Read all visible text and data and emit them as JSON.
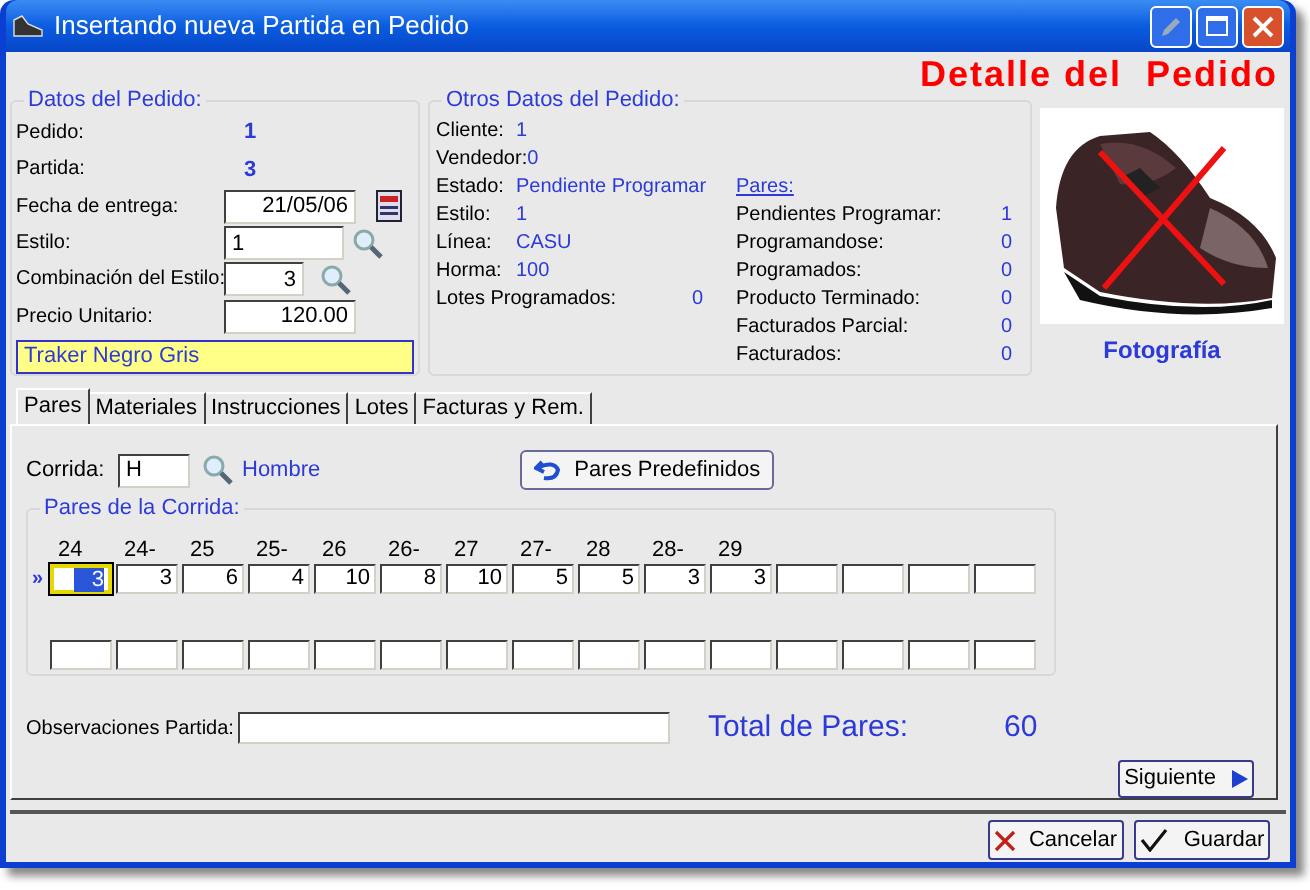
{
  "window": {
    "title": "Insertando nueva Partida en Pedido"
  },
  "heading": "Detalle del  Pedido",
  "datos": {
    "legend": "Datos del Pedido:",
    "fields": [
      {
        "label": "Pedido:",
        "value": "1",
        "kind": "value"
      },
      {
        "label": "Partida:",
        "value": "3",
        "kind": "value"
      },
      {
        "label": "Fecha de entrega:",
        "value": "21/05/06",
        "kind": "date"
      },
      {
        "label": "Estilo:",
        "value": "1",
        "kind": "lookup_left"
      },
      {
        "label": "Combinación del Estilo:",
        "value": "3",
        "kind": "lookup_short"
      },
      {
        "label": "Precio Unitario:",
        "value": "120.00",
        "kind": "input"
      }
    ],
    "description": "Traker Negro Gris"
  },
  "otros": {
    "legend": "Otros Datos del Pedido:",
    "fields": [
      {
        "label": "Cliente:",
        "value": "1"
      },
      {
        "label": "Vendedor:",
        "value": "0"
      },
      {
        "label": "Estado:",
        "value": "Pendiente Programar"
      },
      {
        "label": "Estilo:",
        "value": "1"
      },
      {
        "label": "Línea:",
        "value": "CASU"
      },
      {
        "label": "Horma:",
        "value": "100"
      },
      {
        "label": "Lotes Programados:",
        "value": "0"
      }
    ],
    "pares_title": "Pares:",
    "pares": [
      {
        "label": "Pendientes Programar:",
        "value": "1"
      },
      {
        "label": "Programandose:",
        "value": "0"
      },
      {
        "label": "Programados:",
        "value": "0"
      },
      {
        "label": "Producto Terminado:",
        "value": "0"
      },
      {
        "label": "Facturados Parcial:",
        "value": "0"
      },
      {
        "label": "Facturados:",
        "value": "0"
      }
    ]
  },
  "photo_caption": "Fotografía",
  "tabs": [
    {
      "label": "Pares",
      "selected": true
    },
    {
      "label": "Materiales",
      "selected": false
    },
    {
      "label": "Instrucciones",
      "selected": false
    },
    {
      "label": "Lotes",
      "selected": false
    },
    {
      "label": "Facturas y Rem.",
      "selected": false
    }
  ],
  "corrida": {
    "label": "Corrida:",
    "value": "H",
    "name": "Hombre"
  },
  "predef_button": "Pares Predefinidos",
  "grid": {
    "legend": "Pares de la Corrida:",
    "row_marker": "»",
    "sizes": [
      {
        "size": "24",
        "qty": "3",
        "selected": true
      },
      {
        "size": "24-",
        "qty": "3",
        "selected": false
      },
      {
        "size": "25",
        "qty": "6",
        "selected": false
      },
      {
        "size": "25-",
        "qty": "4",
        "selected": false
      },
      {
        "size": "26",
        "qty": "10",
        "selected": false
      },
      {
        "size": "26-",
        "qty": "8",
        "selected": false
      },
      {
        "size": "27",
        "qty": "10",
        "selected": false
      },
      {
        "size": "27-",
        "qty": "5",
        "selected": false
      },
      {
        "size": "28",
        "qty": "5",
        "selected": false
      },
      {
        "size": "28-",
        "qty": "3",
        "selected": false
      },
      {
        "size": "29",
        "qty": "3",
        "selected": false
      }
    ]
  },
  "observaciones": {
    "label": "Observaciones Partida:"
  },
  "total": {
    "label": "Total de Pares:",
    "value": "60"
  },
  "buttons": {
    "next": "Siguiente",
    "cancel": "Cancelar",
    "save": "Guardar"
  }
}
